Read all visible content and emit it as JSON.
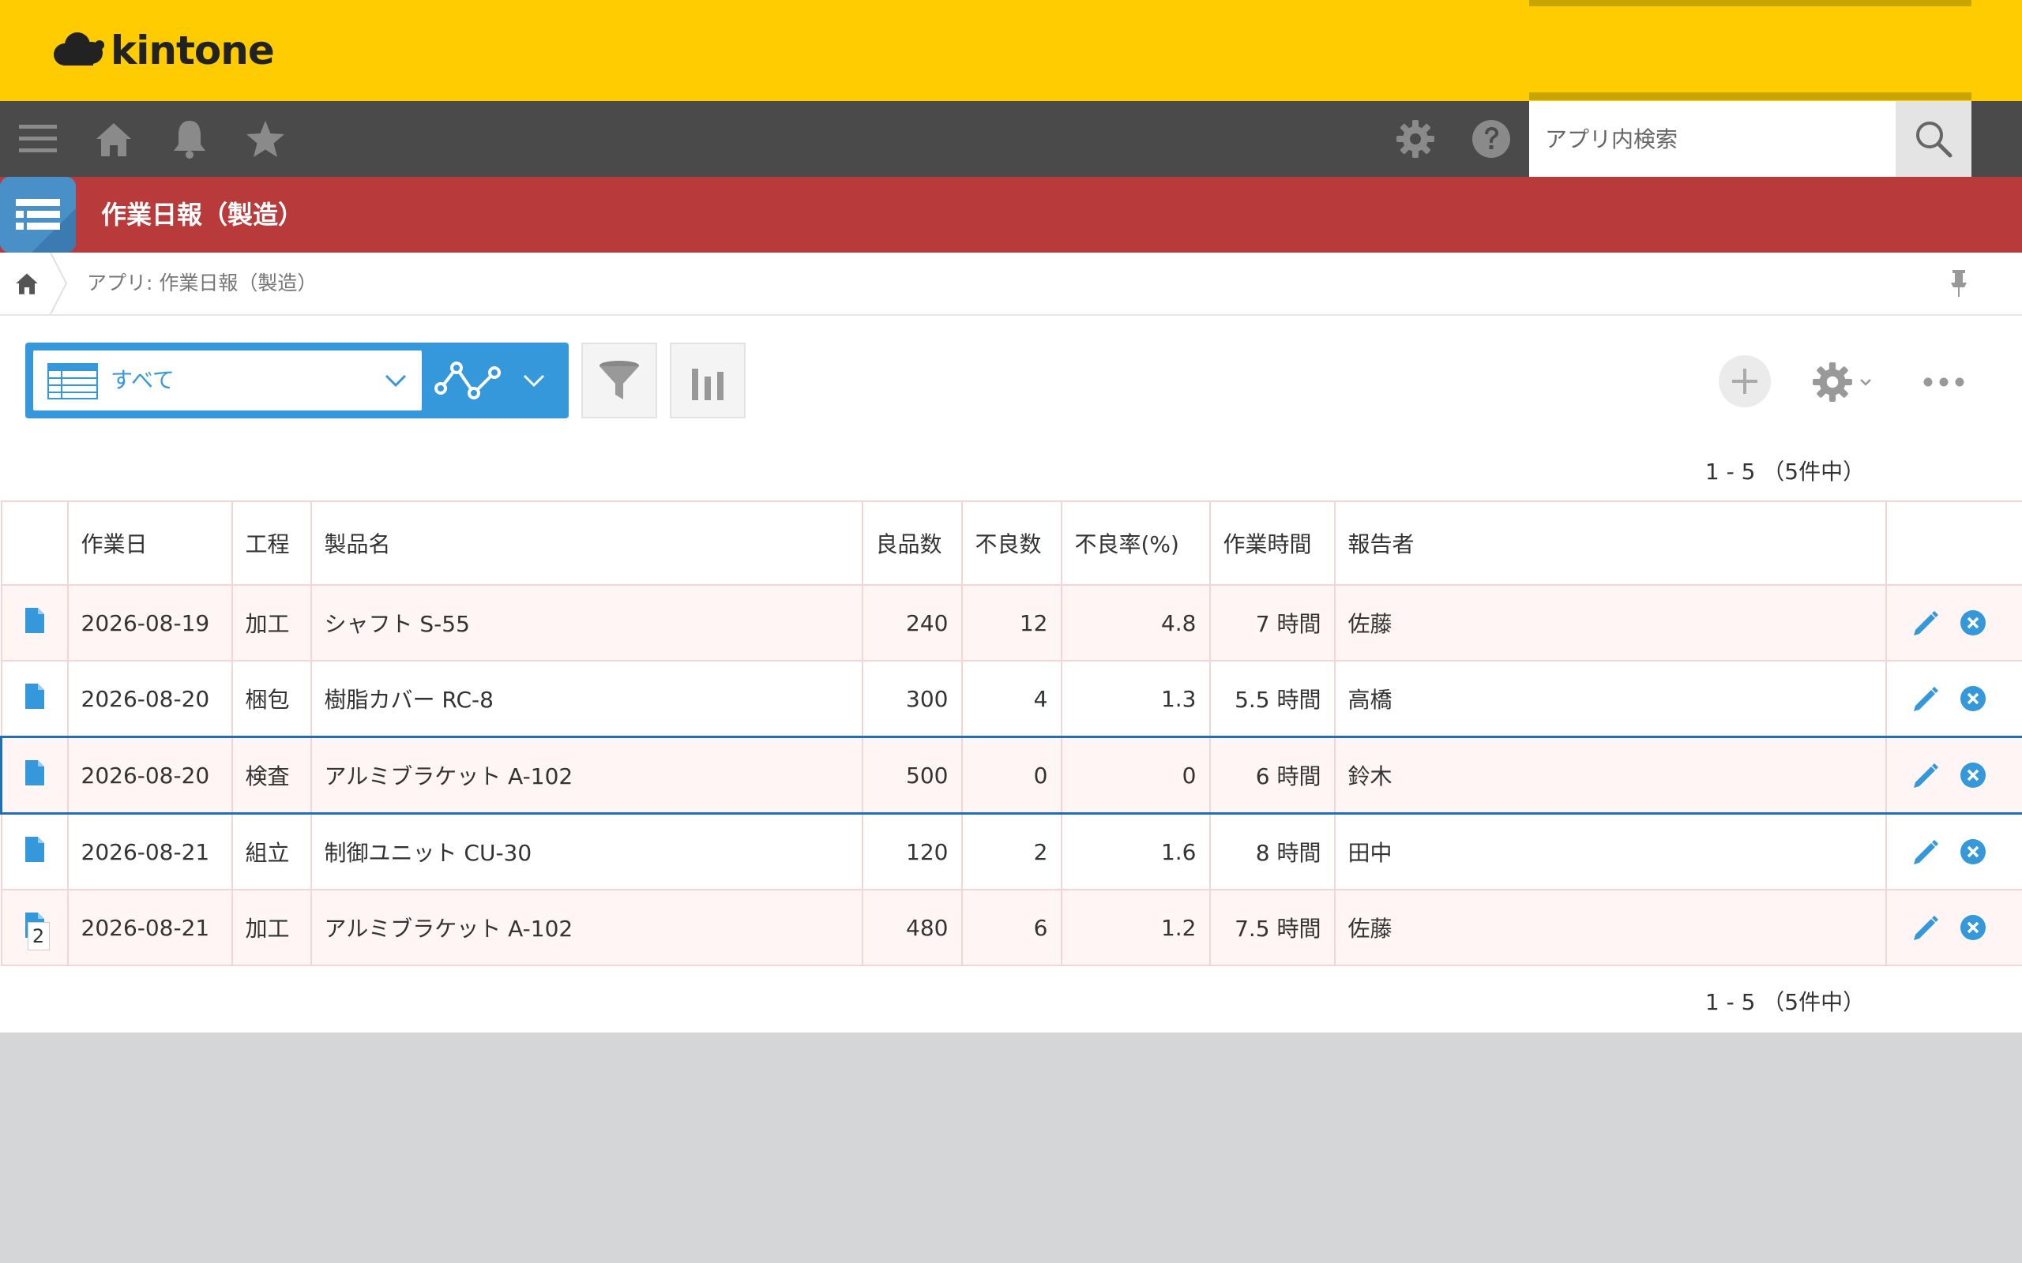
{
  "brand": {
    "logo_text": "kintone"
  },
  "search": {
    "placeholder": "アプリ内検索"
  },
  "app": {
    "title": "作業日報（製造）"
  },
  "breadcrumb": {
    "text": "アプリ: 作業日報（製造）"
  },
  "view": {
    "selected": "すべて"
  },
  "pagination": {
    "top": "1 - 5 （5件中）",
    "bottom": "1 - 5 （5件中）"
  },
  "table": {
    "columns": [
      "作業日",
      "工程",
      "製品名",
      "良品数",
      "不良数",
      "不良率(%)",
      "作業時間",
      "報告者"
    ],
    "rows": [
      {
        "date": "2026-08-19",
        "process": "加工",
        "product": "シャフト S-55",
        "good": "240",
        "defect": "12",
        "rate": "4.8",
        "hours": "7 時間",
        "reporter": "佐藤",
        "badge": ""
      },
      {
        "date": "2026-08-20",
        "process": "梱包",
        "product": "樹脂カバー RC-8",
        "good": "300",
        "defect": "4",
        "rate": "1.3",
        "hours": "5.5 時間",
        "reporter": "高橋",
        "badge": ""
      },
      {
        "date": "2026-08-20",
        "process": "検査",
        "product": "アルミブラケット A-102",
        "good": "500",
        "defect": "0",
        "rate": "0",
        "hours": "6 時間",
        "reporter": "鈴木",
        "badge": ""
      },
      {
        "date": "2026-08-21",
        "process": "組立",
        "product": "制御ユニット CU-30",
        "good": "120",
        "defect": "2",
        "rate": "1.6",
        "hours": "8 時間",
        "reporter": "田中",
        "badge": ""
      },
      {
        "date": "2026-08-21",
        "process": "加工",
        "product": "アルミブラケット A-102",
        "good": "480",
        "defect": "6",
        "rate": "1.2",
        "hours": "7.5 時間",
        "reporter": "佐藤",
        "badge": "2"
      }
    ]
  },
  "colors": {
    "topbar": "#fecc00",
    "navbar": "#4a4a4a",
    "app_header": "#b83a3b",
    "accent": "#3498db"
  },
  "icons": [
    "cloud-logo-icon",
    "menu-icon",
    "home-icon",
    "bell-icon",
    "star-icon",
    "gear-icon",
    "help-icon",
    "search-icon",
    "list-app-icon",
    "pin-icon",
    "table-view-icon",
    "chevron-down-icon",
    "graph-icon",
    "filter-icon",
    "bar-chart-icon",
    "plus-icon",
    "more-icon",
    "document-icon",
    "pencil-icon",
    "close-circle-icon"
  ]
}
